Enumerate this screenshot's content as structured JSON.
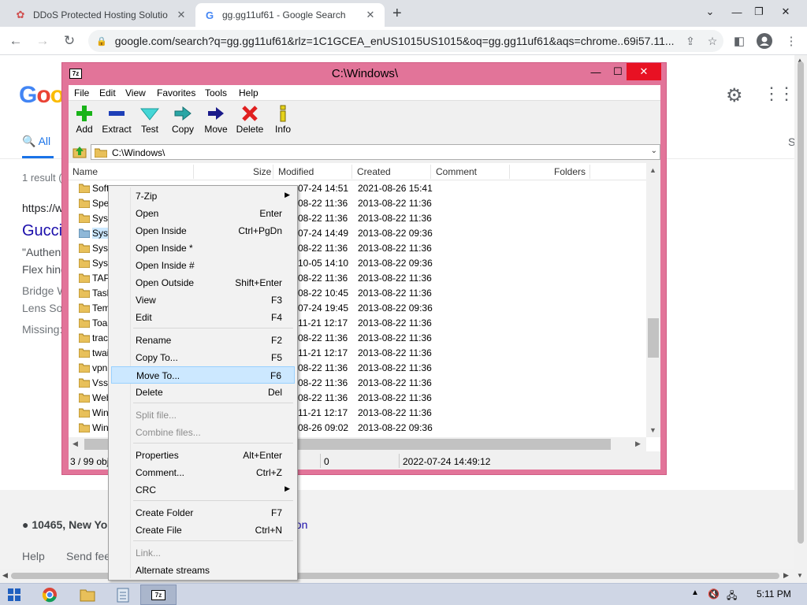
{
  "browser": {
    "tabs": [
      {
        "title": "DDoS Protected Hosting Solutio"
      },
      {
        "title": "gg.gg11uf61 - Google Search"
      }
    ],
    "url": "google.com/search?q=gg.gg11uf61&rlz=1C1GCEA_enUS1015US1015&oq=gg.gg11uf61&aqs=chrome..69i57.11..."
  },
  "google": {
    "logo": "Goo",
    "tab_all": "All",
    "tab_s": "S",
    "result_count": "1 result (",
    "result_url": "https://w",
    "result_title": "Gucci",
    "snippet1": "\"Authent",
    "snippet2": "Flex hing",
    "bridge": "Bridge W",
    "lens": "Lens So",
    "missing": "Missing:",
    "location": "10465, New Yo",
    "update_location": "ation",
    "help": "Help",
    "send_feedback": "Send fee"
  },
  "zip": {
    "title": "C:\\Windows\\",
    "menu": [
      "File",
      "Edit",
      "View",
      "Favorites",
      "Tools",
      "Help"
    ],
    "toolbar": [
      "Add",
      "Extract",
      "Test",
      "Copy",
      "Move",
      "Delete",
      "Info"
    ],
    "path": "C:\\Windows\\",
    "columns": [
      "Name",
      "Size",
      "Modified",
      "Created",
      "Comment",
      "Folders"
    ],
    "rows": [
      {
        "name": "Softw",
        "modified": "-07-24 14:51",
        "created": "2021-08-26 15:41"
      },
      {
        "name": "Speec",
        "modified": "-08-22 11:36",
        "created": "2013-08-22 11:36"
      },
      {
        "name": "Syste",
        "modified": "-08-22 11:36",
        "created": "2013-08-22 11:36"
      },
      {
        "name": "Syste",
        "modified": "-07-24 14:49",
        "created": "2013-08-22 09:36"
      },
      {
        "name": "Syste",
        "modified": "-08-22 11:36",
        "created": "2013-08-22 11:36"
      },
      {
        "name": "SysW",
        "modified": "-10-05 14:10",
        "created": "2013-08-22 09:36"
      },
      {
        "name": "TAPI",
        "modified": "-08-22 11:36",
        "created": "2013-08-22 11:36"
      },
      {
        "name": "Tasks",
        "modified": "-08-22 10:45",
        "created": "2013-08-22 11:36"
      },
      {
        "name": "Temp",
        "modified": "-07-24 19:45",
        "created": "2013-08-22 09:36"
      },
      {
        "name": "Toast",
        "modified": "-11-21 12:17",
        "created": "2013-08-22 11:36"
      },
      {
        "name": "tracin",
        "modified": "-08-22 11:36",
        "created": "2013-08-22 11:36"
      },
      {
        "name": "twain",
        "modified": "-11-21 12:17",
        "created": "2013-08-22 11:36"
      },
      {
        "name": "vpnp",
        "modified": "-08-22 11:36",
        "created": "2013-08-22 11:36"
      },
      {
        "name": "Vss",
        "modified": "-08-22 11:36",
        "created": "2013-08-22 11:36"
      },
      {
        "name": "Web",
        "modified": "-08-22 11:36",
        "created": "2013-08-22 11:36"
      },
      {
        "name": "WinS",
        "modified": "-11-21 12:17",
        "created": "2013-08-22 11:36"
      },
      {
        "name": "WinS",
        "modified": "-08-26 09:02",
        "created": "2013-08-22 09:36"
      }
    ],
    "status": {
      "selection": "3 / 99 obj",
      "size": "0",
      "modified": "2022-07-24 14:49:12"
    }
  },
  "context_menu": [
    {
      "label": "7-Zip",
      "shortcut": "",
      "submenu": true
    },
    {
      "label": "Open",
      "shortcut": "Enter"
    },
    {
      "label": "Open Inside",
      "shortcut": "Ctrl+PgDn"
    },
    {
      "label": "Open Inside *",
      "shortcut": ""
    },
    {
      "label": "Open Inside #",
      "shortcut": ""
    },
    {
      "label": "Open Outside",
      "shortcut": "Shift+Enter"
    },
    {
      "label": "View",
      "shortcut": "F3"
    },
    {
      "label": "Edit",
      "shortcut": "F4"
    },
    {
      "label": "Rename",
      "shortcut": "F2"
    },
    {
      "label": "Copy To...",
      "shortcut": "F5"
    },
    {
      "label": "Move To...",
      "shortcut": "F6"
    },
    {
      "label": "Delete",
      "shortcut": "Del"
    },
    {
      "label": "Split file...",
      "shortcut": ""
    },
    {
      "label": "Combine files...",
      "shortcut": ""
    },
    {
      "label": "Properties",
      "shortcut": "Alt+Enter"
    },
    {
      "label": "Comment...",
      "shortcut": "Ctrl+Z"
    },
    {
      "label": "CRC",
      "shortcut": "",
      "submenu": true
    },
    {
      "label": "Create Folder",
      "shortcut": "F7"
    },
    {
      "label": "Create File",
      "shortcut": "Ctrl+N"
    },
    {
      "label": "Link...",
      "shortcut": ""
    },
    {
      "label": "Alternate streams",
      "shortcut": ""
    }
  ],
  "taskbar": {
    "clock": "5:11 PM"
  },
  "colors": {
    "zip_frame": "#e27499",
    "close_red": "#e81123",
    "highlight": "#cce8ff",
    "google_link": "#1a0dab"
  }
}
